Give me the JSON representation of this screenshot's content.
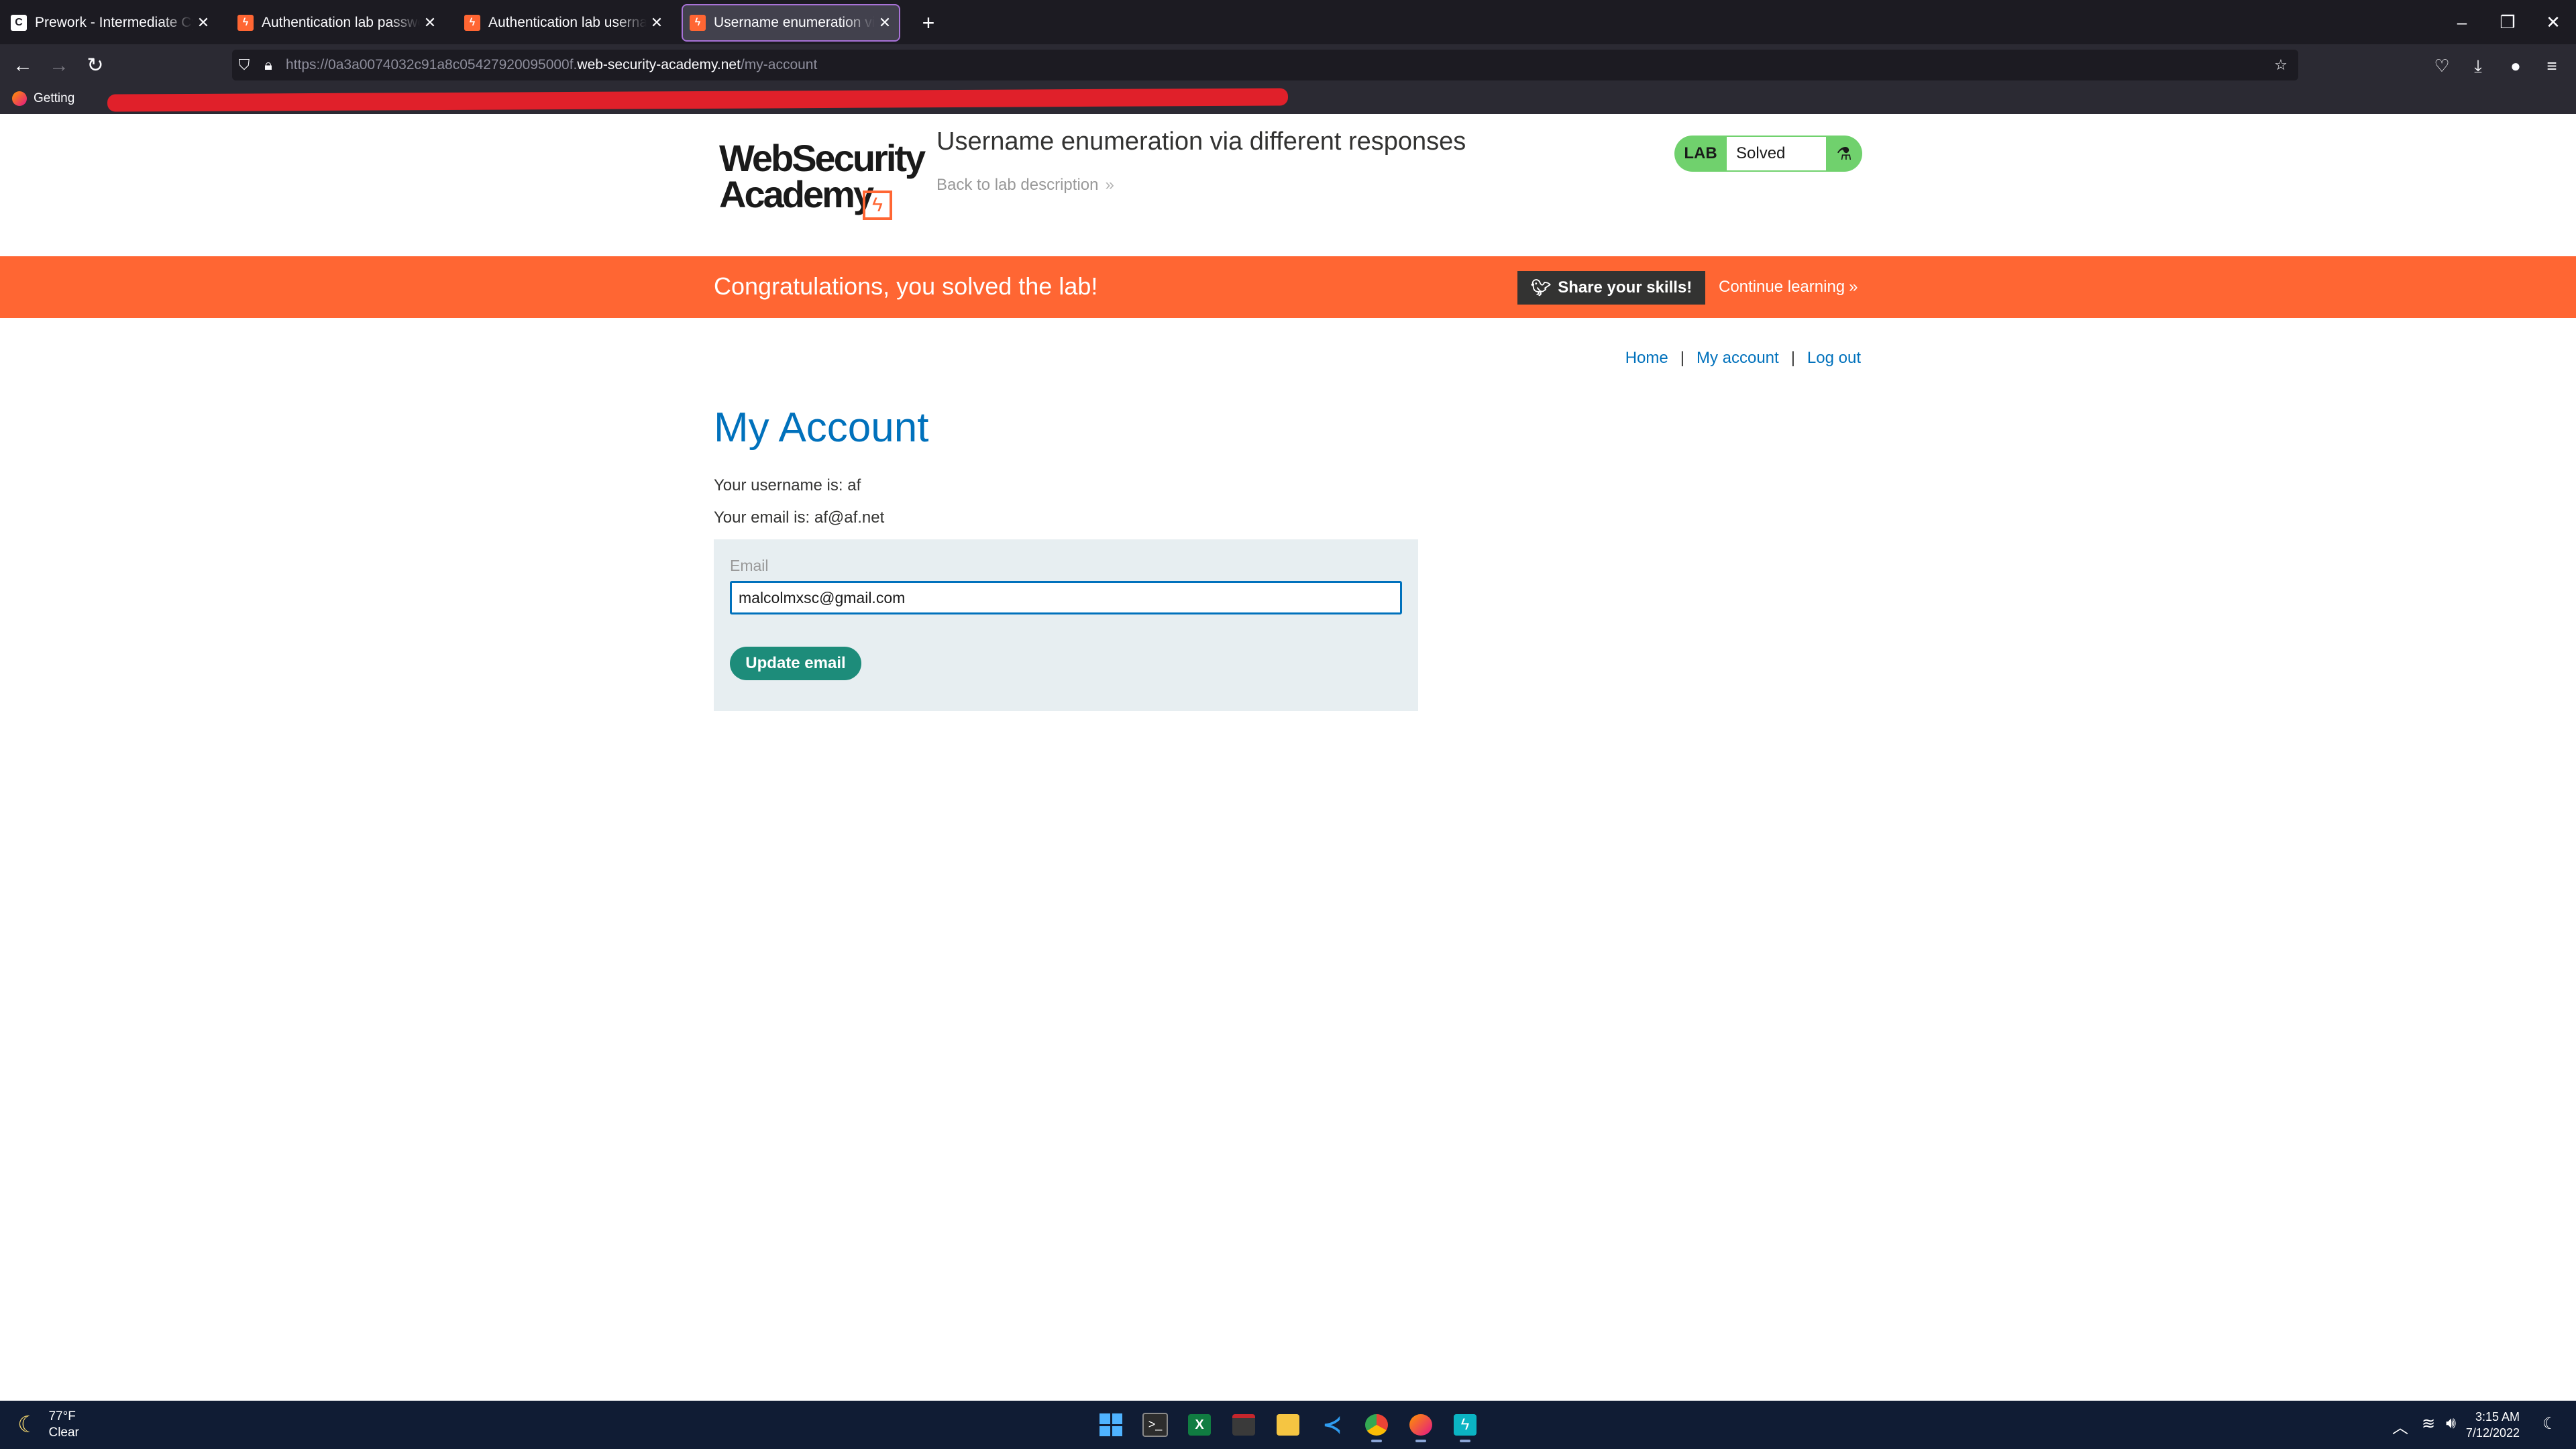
{
  "browser": {
    "tabs": [
      {
        "title": "Prework - Intermediate Cyberse",
        "favicon": "codepath-icon",
        "active": false
      },
      {
        "title": "Authentication lab passwords |",
        "favicon": "wsa-icon",
        "active": false
      },
      {
        "title": "Authentication lab usernames |",
        "favicon": "wsa-icon",
        "active": false
      },
      {
        "title": "Username enumeration via diff",
        "favicon": "wsa-icon",
        "active": true
      }
    ],
    "url_prefix": "https://0a3a0074032c91a8c05427920095000f.",
    "url_domain": "web-security-academy.net",
    "url_path": "/my-account",
    "bookmark": "Getting"
  },
  "header": {
    "logo_line1": "WebSecurity",
    "logo_line2": "Academy",
    "lab_title": "Username enumeration via different responses",
    "back_link": "Back to lab description",
    "lab_badge": "LAB",
    "lab_status": "Solved"
  },
  "banner": {
    "message": "Congratulations, you solved the lab!",
    "share_label": "Share your skills!",
    "continue_label": "Continue learning"
  },
  "nav": {
    "home": "Home",
    "my_account": "My account",
    "logout": "Log out",
    "sep": "|"
  },
  "account": {
    "heading": "My Account",
    "username_line": "Your username is: af",
    "email_line": "Your email is: af@af.net",
    "email_label": "Email",
    "email_value": "malcolmxsc@gmail.com",
    "update_button": "Update email"
  },
  "taskbar": {
    "temperature": "77°F",
    "condition": "Clear",
    "time": "3:15 AM",
    "date": "7/12/2022"
  },
  "colors": {
    "banner": "#ff6633",
    "link": "#0071bc",
    "button": "#1d8c7a",
    "lab_solved": "#70d16d"
  }
}
